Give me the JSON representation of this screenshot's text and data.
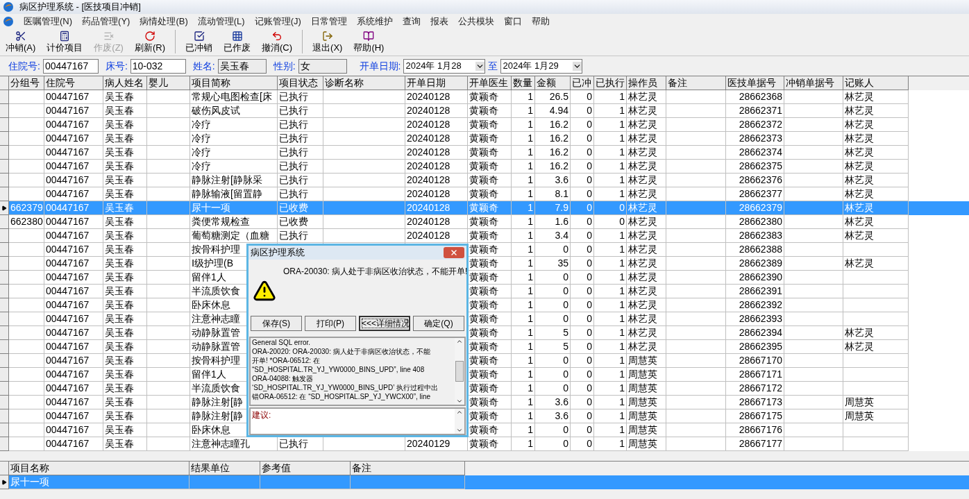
{
  "window": {
    "title": "病区护理系统 - [医技项目冲销]"
  },
  "menu": [
    {
      "label": "医嘱管理(N)"
    },
    {
      "label": "药品管理(Y)"
    },
    {
      "label": "病情处理(B)"
    },
    {
      "label": "流动管理(L)"
    },
    {
      "label": "记账管理(J)"
    },
    {
      "label": "日常管理"
    },
    {
      "label": "系统维护"
    },
    {
      "label": "查询"
    },
    {
      "label": "报表"
    },
    {
      "label": "公共模块"
    },
    {
      "label": "窗口"
    },
    {
      "label": "帮助"
    }
  ],
  "toolbar": [
    {
      "kind": "writeoff",
      "label": "冲销(A)",
      "disabled": false
    },
    {
      "kind": "price",
      "label": "计价项目",
      "disabled": false
    },
    {
      "kind": "void",
      "label": "作废(Z)",
      "disabled": true
    },
    {
      "kind": "refresh",
      "label": "刷新(R)",
      "disabled": false
    },
    {
      "kind": "done",
      "label": "已冲销",
      "disabled": false,
      "group_start": true
    },
    {
      "kind": "grid",
      "label": "已作废",
      "disabled": false
    },
    {
      "kind": "undo",
      "label": "撤消(C)",
      "disabled": false
    },
    {
      "kind": "exit",
      "label": "退出(X)",
      "disabled": false,
      "group_start": true
    },
    {
      "kind": "help",
      "label": "帮助(H)",
      "disabled": false
    }
  ],
  "filters": [
    {
      "label": "住院号:",
      "value": "00447167",
      "readonly": false
    },
    {
      "label": "床号:",
      "value": "10-032",
      "readonly": false
    },
    {
      "label": "姓名:",
      "value": "吴玉春",
      "readonly": true
    },
    {
      "label": "性别:",
      "value": "女",
      "readonly": true
    }
  ],
  "date_range": {
    "label": "开单日期:",
    "from": "2024年 1月28",
    "separator": "至",
    "to": "2024年 1月29"
  },
  "table": {
    "columns": [
      "分组号",
      "住院号",
      "病人姓名",
      "婴儿",
      "项目简称",
      "项目状态",
      "诊断名称",
      "开单日期",
      "开单医生",
      "数量",
      "金额",
      "已冲",
      "已执行",
      "操作员",
      "备注",
      "医技单据号",
      "冲销单据号",
      "记账人"
    ],
    "rows": [
      {
        "selected": false,
        "cells": [
          null,
          "00447167",
          "吴玉春",
          null,
          "常规心电图检查[床",
          "已执行",
          null,
          "20240128",
          "黄颖奇",
          "1",
          "26.5",
          "0",
          "1",
          "林艺灵",
          null,
          "28662368",
          null,
          "林艺灵"
        ]
      },
      {
        "selected": false,
        "cells": [
          null,
          "00447167",
          "吴玉春",
          null,
          "破伤风皮试",
          "已执行",
          null,
          "20240128",
          "黄颖奇",
          "1",
          "4.94",
          "0",
          "1",
          "林艺灵",
          null,
          "28662371",
          null,
          "林艺灵"
        ]
      },
      {
        "selected": false,
        "cells": [
          null,
          "00447167",
          "吴玉春",
          null,
          "冷疗",
          "已执行",
          null,
          "20240128",
          "黄颖奇",
          "1",
          "16.2",
          "0",
          "1",
          "林艺灵",
          null,
          "28662372",
          null,
          "林艺灵"
        ]
      },
      {
        "selected": false,
        "cells": [
          null,
          "00447167",
          "吴玉春",
          null,
          "冷疗",
          "已执行",
          null,
          "20240128",
          "黄颖奇",
          "1",
          "16.2",
          "0",
          "1",
          "林艺灵",
          null,
          "28662373",
          null,
          "林艺灵"
        ]
      },
      {
        "selected": false,
        "cells": [
          null,
          "00447167",
          "吴玉春",
          null,
          "冷疗",
          "已执行",
          null,
          "20240128",
          "黄颖奇",
          "1",
          "16.2",
          "0",
          "1",
          "林艺灵",
          null,
          "28662374",
          null,
          "林艺灵"
        ]
      },
      {
        "selected": false,
        "cells": [
          null,
          "00447167",
          "吴玉春",
          null,
          "冷疗",
          "已执行",
          null,
          "20240128",
          "黄颖奇",
          "1",
          "16.2",
          "0",
          "1",
          "林艺灵",
          null,
          "28662375",
          null,
          "林艺灵"
        ]
      },
      {
        "selected": false,
        "cells": [
          null,
          "00447167",
          "吴玉春",
          null,
          "静脉注射[静脉采",
          "已执行",
          null,
          "20240128",
          "黄颖奇",
          "1",
          "3.6",
          "0",
          "1",
          "林艺灵",
          null,
          "28662376",
          null,
          "林艺灵"
        ]
      },
      {
        "selected": false,
        "cells": [
          null,
          "00447167",
          "吴玉春",
          null,
          "静脉输液[留置静",
          "已执行",
          null,
          "20240128",
          "黄颖奇",
          "1",
          "8.1",
          "0",
          "1",
          "林艺灵",
          null,
          "28662377",
          null,
          "林艺灵"
        ]
      },
      {
        "selected": true,
        "cells": [
          "662379",
          "00447167",
          "吴玉春",
          null,
          "尿十一项",
          "已收费",
          null,
          "20240128",
          "黄颖奇",
          "1",
          "7.9",
          "0",
          "0",
          "林艺灵",
          null,
          "28662379",
          null,
          "林艺灵"
        ]
      },
      {
        "selected": false,
        "cells": [
          "662380",
          "00447167",
          "吴玉春",
          null,
          "粪便常规检查",
          "已收费",
          null,
          "20240128",
          "黄颖奇",
          "1",
          "1.6",
          "0",
          "0",
          "林艺灵",
          null,
          "28662380",
          null,
          "林艺灵"
        ]
      },
      {
        "selected": false,
        "cells": [
          null,
          "00447167",
          "吴玉春",
          null,
          "葡萄糖测定（血糖",
          "已执行",
          null,
          "20240128",
          "黄颖奇",
          "1",
          "3.4",
          "0",
          "1",
          "林艺灵",
          null,
          "28662383",
          null,
          "林艺灵"
        ]
      },
      {
        "selected": false,
        "cells": [
          null,
          "00447167",
          "吴玉春",
          null,
          "按骨科护理",
          null,
          null,
          null,
          "黄颖奇",
          "1",
          "0",
          "0",
          "1",
          "林艺灵",
          null,
          "28662388",
          null,
          null
        ]
      },
      {
        "selected": false,
        "cells": [
          null,
          "00447167",
          "吴玉春",
          null,
          "Ⅰ级护理(B",
          null,
          null,
          null,
          "黄颖奇",
          "1",
          "35",
          "0",
          "1",
          "林艺灵",
          null,
          "28662389",
          null,
          "林艺灵"
        ]
      },
      {
        "selected": false,
        "cells": [
          null,
          "00447167",
          "吴玉春",
          null,
          "留伴1人",
          null,
          null,
          null,
          "黄颖奇",
          "1",
          "0",
          "0",
          "1",
          "林艺灵",
          null,
          "28662390",
          null,
          null
        ]
      },
      {
        "selected": false,
        "cells": [
          null,
          "00447167",
          "吴玉春",
          null,
          "半流质饮食",
          null,
          null,
          null,
          "黄颖奇",
          "1",
          "0",
          "0",
          "1",
          "林艺灵",
          null,
          "28662391",
          null,
          null
        ]
      },
      {
        "selected": false,
        "cells": [
          null,
          "00447167",
          "吴玉春",
          null,
          "卧床休息",
          null,
          null,
          null,
          "黄颖奇",
          "1",
          "0",
          "0",
          "1",
          "林艺灵",
          null,
          "28662392",
          null,
          null
        ]
      },
      {
        "selected": false,
        "cells": [
          null,
          "00447167",
          "吴玉春",
          null,
          "注意神志瞳",
          null,
          null,
          null,
          "黄颖奇",
          "1",
          "0",
          "0",
          "1",
          "林艺灵",
          null,
          "28662393",
          null,
          null
        ]
      },
      {
        "selected": false,
        "cells": [
          null,
          "00447167",
          "吴玉春",
          null,
          "动静脉置管",
          null,
          null,
          null,
          "黄颖奇",
          "1",
          "5",
          "0",
          "1",
          "林艺灵",
          null,
          "28662394",
          null,
          "林艺灵"
        ]
      },
      {
        "selected": false,
        "cells": [
          null,
          "00447167",
          "吴玉春",
          null,
          "动静脉置管",
          null,
          null,
          null,
          "黄颖奇",
          "1",
          "5",
          "0",
          "1",
          "林艺灵",
          null,
          "28662395",
          null,
          "林艺灵"
        ]
      },
      {
        "selected": false,
        "cells": [
          null,
          "00447167",
          "吴玉春",
          null,
          "按骨科护理",
          null,
          null,
          null,
          "黄颖奇",
          "1",
          "0",
          "0",
          "1",
          "周慧英",
          null,
          "28667170",
          null,
          null
        ]
      },
      {
        "selected": false,
        "cells": [
          null,
          "00447167",
          "吴玉春",
          null,
          "留伴1人",
          null,
          null,
          null,
          "黄颖奇",
          "1",
          "0",
          "0",
          "1",
          "周慧英",
          null,
          "28667171",
          null,
          null
        ]
      },
      {
        "selected": false,
        "cells": [
          null,
          "00447167",
          "吴玉春",
          null,
          "半流质饮食",
          null,
          null,
          null,
          "黄颖奇",
          "1",
          "0",
          "0",
          "1",
          "周慧英",
          null,
          "28667172",
          null,
          null
        ]
      },
      {
        "selected": false,
        "cells": [
          null,
          "00447167",
          "吴玉春",
          null,
          "静脉注射[静",
          null,
          null,
          null,
          "黄颖奇",
          "1",
          "3.6",
          "0",
          "1",
          "周慧英",
          null,
          "28667173",
          null,
          "周慧英"
        ]
      },
      {
        "selected": false,
        "cells": [
          null,
          "00447167",
          "吴玉春",
          null,
          "静脉注射[静",
          null,
          null,
          null,
          "黄颖奇",
          "1",
          "3.6",
          "0",
          "1",
          "周慧英",
          null,
          "28667175",
          null,
          "周慧英"
        ]
      },
      {
        "selected": false,
        "cells": [
          null,
          "00447167",
          "吴玉春",
          null,
          "卧床休息",
          null,
          null,
          null,
          "黄颖奇",
          "1",
          "0",
          "0",
          "1",
          "周慧英",
          null,
          "28667176",
          null,
          null
        ]
      },
      {
        "selected": false,
        "cells": [
          null,
          "00447167",
          "吴玉春",
          null,
          "注意神志瞳孔",
          "已执行",
          null,
          "20240129",
          "黄颖奇",
          "1",
          "0",
          "0",
          "1",
          "周慧英",
          null,
          "28667177",
          null,
          null
        ]
      }
    ]
  },
  "detail_table": {
    "columns": [
      "项目名称",
      "结果单位",
      "参考值",
      "备注"
    ],
    "rows": [
      {
        "selected": true,
        "cells": [
          "尿十一项",
          null,
          null,
          null
        ]
      }
    ]
  },
  "dialog": {
    "title": "病区护理系统",
    "message": "ORA-20030: 病人处于非病区收治状态，不能开单!",
    "buttons": [
      {
        "label": "保存(S)",
        "focused": false
      },
      {
        "label": "打印(P)",
        "focused": false
      },
      {
        "label": "<<<详细情况",
        "focused": true
      },
      {
        "label": "确定(Q)",
        "focused": false
      }
    ],
    "details": [
      "General SQL error.",
      "ORA-20020: ORA-20030: 病人处于非病区收治状态，不能",
      "开单! *ORA-06512: 在",
      "“SD_HOSPITAL.TR_YJ_YW0000_BINS_UPD”, line 408",
      "ORA-04088: 触发器",
      "‘SD_HOSPITAL.TR_YJ_YW0000_BINS_UPD’ 执行过程中出",
      "错ORA-06512: 在 “SD_HOSPITAL.SP_YJ_YWCX00”, line"
    ],
    "advice_label": "建议:"
  }
}
